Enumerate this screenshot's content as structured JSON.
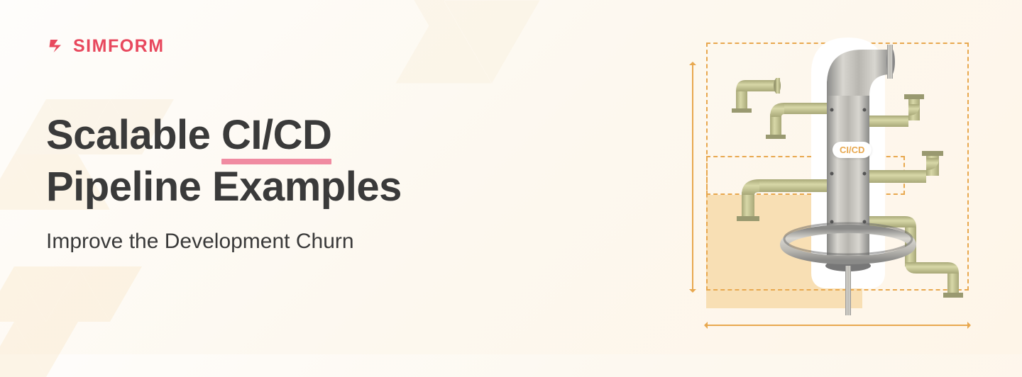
{
  "brand": {
    "name": "SIMFORM",
    "color": "#e8485d"
  },
  "hero": {
    "title_prefix": "Scalable ",
    "title_highlight": "CI/CD",
    "title_line2": "Pipeline Examples",
    "subtitle": "Improve the Development Churn"
  },
  "illustration": {
    "badge_text": "CI/CD"
  }
}
